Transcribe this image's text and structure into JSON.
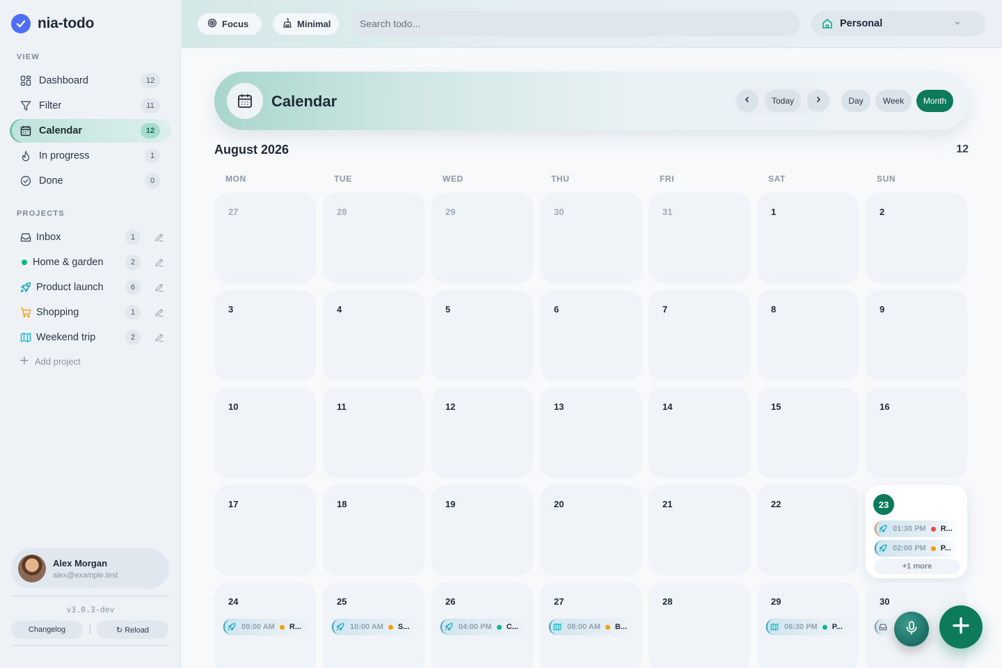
{
  "app": {
    "name": "nia-todo",
    "version": "v3.0.3-dev"
  },
  "sidebar": {
    "view_label": "VIEW",
    "views": [
      {
        "label": "Dashboard",
        "count": "12",
        "icon": "dashboard-icon"
      },
      {
        "label": "Filter",
        "count": "11",
        "icon": "filter-icon"
      },
      {
        "label": "Calendar",
        "count": "12",
        "icon": "calendar-icon",
        "active": true
      },
      {
        "label": "In progress",
        "count": "1",
        "icon": "flame-icon"
      },
      {
        "label": "Done",
        "count": "0",
        "icon": "check-circle-icon"
      }
    ],
    "projects_label": "PROJECTS",
    "projects": [
      {
        "label": "Inbox",
        "count": "1",
        "icon": "inbox-icon"
      },
      {
        "label": "Home & garden",
        "count": "2",
        "icon": "dot-icon",
        "color": "#10b981"
      },
      {
        "label": "Product launch",
        "count": "6",
        "icon": "rocket-icon",
        "color": "#0ea5c6"
      },
      {
        "label": "Shopping",
        "count": "1",
        "icon": "cart-icon",
        "color": "#f59e0b"
      },
      {
        "label": "Weekend trip",
        "count": "2",
        "icon": "map-icon",
        "color": "#06b6d4"
      }
    ],
    "add_project": "Add project",
    "user": {
      "name": "Alex Morgan",
      "email": "alex@example.test"
    },
    "changelog": "Changelog",
    "reload": "↻ Reload"
  },
  "topbar": {
    "focus": "Focus",
    "minimal": "Minimal",
    "search_placeholder": "Search todo...",
    "workspace": "Personal"
  },
  "calendar": {
    "title": "Calendar",
    "today": "Today",
    "views": [
      "Day",
      "Week",
      "Month"
    ],
    "active_view": "Month",
    "month_label": "August 2026",
    "count": "12",
    "weekdays": [
      "MON",
      "TUE",
      "WED",
      "THU",
      "FRI",
      "SAT",
      "SUN"
    ],
    "weeks": [
      [
        {
          "d": "27",
          "muted": true
        },
        {
          "d": "28",
          "muted": true
        },
        {
          "d": "29",
          "muted": true
        },
        {
          "d": "30",
          "muted": true
        },
        {
          "d": "31",
          "muted": true
        },
        {
          "d": "1"
        },
        {
          "d": "2"
        }
      ],
      [
        {
          "d": "3"
        },
        {
          "d": "4"
        },
        {
          "d": "5"
        },
        {
          "d": "6"
        },
        {
          "d": "7"
        },
        {
          "d": "8"
        },
        {
          "d": "9"
        }
      ],
      [
        {
          "d": "10"
        },
        {
          "d": "11"
        },
        {
          "d": "12"
        },
        {
          "d": "13"
        },
        {
          "d": "14"
        },
        {
          "d": "15"
        },
        {
          "d": "16"
        }
      ],
      [
        {
          "d": "17"
        },
        {
          "d": "18"
        },
        {
          "d": "19"
        },
        {
          "d": "20"
        },
        {
          "d": "21"
        },
        {
          "d": "22"
        },
        {
          "d": "23",
          "today": true,
          "more": "+1 more",
          "events": [
            {
              "time": "01:30 PM",
              "title": "R...",
              "dot": "#ef4444",
              "icon": "rocket-icon",
              "accent": "#f08a4b"
            },
            {
              "time": "02:00 PM",
              "title": "P...",
              "dot": "#f59e0b",
              "icon": "rocket-icon",
              "accent": "#3aa0c8"
            }
          ]
        }
      ],
      [
        {
          "d": "24",
          "events": [
            {
              "time": "09:00 AM",
              "title": "R...",
              "dot": "#f59e0b",
              "icon": "rocket-icon",
              "accent": "#3aa0c8"
            }
          ]
        },
        {
          "d": "25",
          "events": [
            {
              "time": "10:00 AM",
              "title": "S...",
              "dot": "#f59e0b",
              "icon": "rocket-icon",
              "accent": "#3aa0c8"
            }
          ]
        },
        {
          "d": "26",
          "events": [
            {
              "time": "04:00 PM",
              "title": "C...",
              "dot": "#10b981",
              "icon": "rocket-icon",
              "accent": "#3aa0c8"
            }
          ]
        },
        {
          "d": "27",
          "events": [
            {
              "time": "08:00 AM",
              "title": "B...",
              "dot": "#f59e0b",
              "icon": "map-icon",
              "accent": "#3aa0c8"
            }
          ]
        },
        {
          "d": "28"
        },
        {
          "d": "29",
          "events": [
            {
              "time": "06:30 PM",
              "title": "P...",
              "dot": "#10b981",
              "icon": "map-icon",
              "accent": "#3aa0c8"
            }
          ]
        },
        {
          "d": "30",
          "events": [
            {
              "time": "",
              "title": "",
              "dot": "#10b981",
              "icon": "inbox-icon",
              "accent": "#8a96a5"
            }
          ]
        }
      ]
    ]
  },
  "colors": {
    "accent": "#0e7a5c",
    "brand": "#4f6ef7"
  }
}
